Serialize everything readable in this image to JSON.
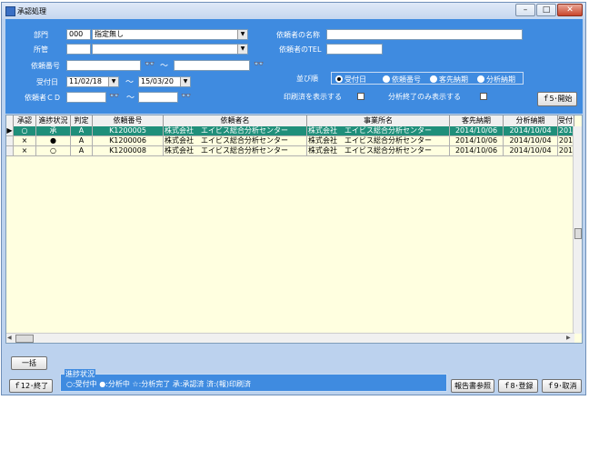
{
  "window": {
    "title": "承認処理",
    "controls": {
      "minimize": "–",
      "maximize": "□",
      "close": "✕"
    }
  },
  "filters": {
    "bumon_label": "部門",
    "bumon_code": "000",
    "bumon_value": "指定無し",
    "shokan_label": "所管",
    "shokan_code": "",
    "shokan_value": "",
    "irai_no_label": "依頼番号",
    "irai_no_from": "",
    "irai_no_to": "",
    "uketsuke_label": "受付日",
    "uketsuke_from": "11/02/18",
    "uketsuke_to": "15/03/20",
    "iraisha_cd_label": "依頼者ＣＤ",
    "iraisha_cd_from": "",
    "iraisha_cd_to": "",
    "tilde": "～",
    "iraisha_name_label": "依頼者の名称",
    "iraisha_name_value": "",
    "iraisha_tel_label": "依頼者のTEL",
    "iraisha_tel_value": "",
    "sort_label": "並び順",
    "sort_options": [
      "受付日",
      "依頼番号",
      "客先納期",
      "分析納期"
    ],
    "sort_selected": 0,
    "print_done_label": "印刷済を表示する",
    "analysis_done_label": "分析終了のみ表示する",
    "start_button": "ｆ5･開始"
  },
  "grid": {
    "headers": [
      "承認",
      "進捗状況",
      "判定",
      "依頼番号",
      "依頼者名",
      "事業所名",
      "客先納期",
      "分析納期",
      "受付日"
    ],
    "rows": [
      {
        "indicator": "▶",
        "cells": [
          "○",
          "承",
          "A",
          "K1200005",
          "株式会社　エイビス総合分析センター",
          "株式会社　エイビス総合分析センター",
          "2014/10/06",
          "2014/10/04",
          "201"
        ],
        "selected": true
      },
      {
        "indicator": "",
        "cells": [
          "×",
          "●",
          "A",
          "K1200006",
          "株式会社　エイビス総合分析センター",
          "株式会社　エイビス総合分析センター",
          "2014/10/06",
          "2014/10/04",
          "201"
        ],
        "selected": false
      },
      {
        "indicator": "",
        "cells": [
          "×",
          "○",
          "A",
          "K1200008",
          "株式会社　エイビス総合分析センター",
          "株式会社　エイビス総合分析センター",
          "2014/10/06",
          "2014/10/04",
          "201"
        ],
        "selected": false
      }
    ]
  },
  "buttons": {
    "ikkatsu": "一括",
    "f12_exit": "ｆ12･終了",
    "report_ref": "報告書参照",
    "f8_register": "ｆ8･登録",
    "f9_cancel": "ｆ9･取消"
  },
  "legend": {
    "title": "進捗状況",
    "text": "○:受付中 ●:分析中 ☆:分析完了 承:承認済 済:(報)印刷済"
  },
  "icons": {
    "binoculars": "binoculars-icon"
  }
}
